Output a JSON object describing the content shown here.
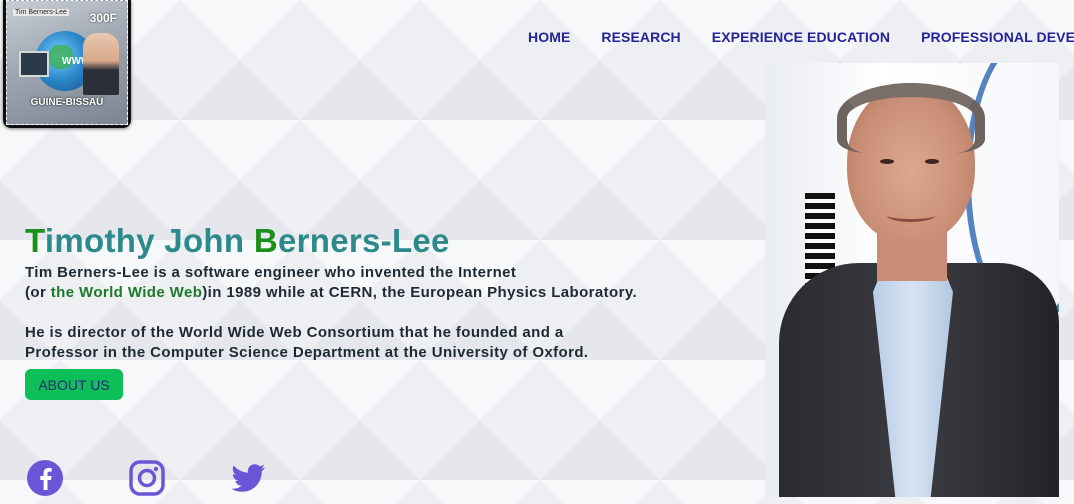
{
  "logo": {
    "stamp_top": "Tim Berners-Lee",
    "stamp_value": "300F",
    "stamp_www": "WWW",
    "stamp_country": "GUINE-BISSAU"
  },
  "nav": {
    "items": [
      "HOME",
      "RESEARCH",
      "EXPERIENCE EDUCATION",
      "PROFESSIONAL DEVELOP"
    ]
  },
  "hero": {
    "title_t": "T",
    "title_part1": "imothy John ",
    "title_b": "B",
    "title_part2": "erners-Lee",
    "line1": "Tim Berners-Lee is a software engineer who invented the Internet",
    "line2_pre": "(or ",
    "line2_link": "the World Wide Web",
    "line2_post": ")in 1989 while at CERN, the European Physics Laboratory.",
    "line3": "He is director of the World Wide Web Consortium that he founded and a",
    "line4": "Professor in the Computer Science Department at the University of Oxford.",
    "button_label": "ABOUT US"
  },
  "social": {
    "facebook_color": "#6a55d6",
    "instagram_color": "#6a55d6",
    "twitter_color": "#6a55d6"
  },
  "colors": {
    "nav_text": "#24239a",
    "title_teal": "#2c8a8b",
    "title_green": "#1a8f1a",
    "button_bg": "#0dbf57"
  }
}
